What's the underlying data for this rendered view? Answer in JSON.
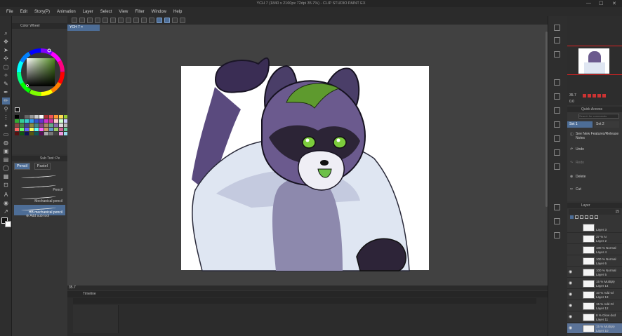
{
  "window": {
    "title": "YCH 7 (1840 x 2160px 72dpi 35.7%)  - CLIP STUDIO PAINT EX",
    "controls": [
      "—",
      "☐",
      "✕"
    ]
  },
  "menu": [
    "File",
    "Edit",
    "Story(P)",
    "Animation",
    "Layer",
    "Select",
    "View",
    "Filter",
    "Window",
    "Help"
  ],
  "color_panel": {
    "title": "Color Wheel",
    "main_color": "#1a1a2e",
    "sub_color": "#ffffff"
  },
  "subtool": {
    "header": "Sub Tool: Pe",
    "tabs": [
      {
        "label": "Pencil",
        "active": true
      },
      {
        "label": "Pastel",
        "active": false
      }
    ],
    "brushes": [
      {
        "label": "",
        "selected": false
      },
      {
        "label": "Pencil",
        "selected": false
      },
      {
        "label": "Mechanical pencil",
        "selected": false
      },
      {
        "label": "HB mechanical pencil",
        "selected": true
      }
    ],
    "add_label": "Add sub tool"
  },
  "document": {
    "tab_label": "YCH 7",
    "zoom": "35.7"
  },
  "timeline": {
    "title": "Timeline"
  },
  "quick_access": {
    "title": "Quick Access",
    "search_placeholder": "Search for commands",
    "sets": [
      {
        "label": "Set 1",
        "active": true
      },
      {
        "label": "Set 2",
        "active": false
      }
    ],
    "items": [
      {
        "label": "See New Features/Release Notes",
        "icon": "info-icon"
      },
      {
        "label": "Undo",
        "icon": "undo-icon"
      },
      {
        "label": "Redo",
        "icon": "redo-icon"
      },
      {
        "label": "Delete",
        "icon": "delete-icon"
      },
      {
        "label": "Cut",
        "icon": "cut-icon"
      }
    ]
  },
  "navigator": {
    "zoom": "35.7",
    "rotation": "0.0"
  },
  "layers": {
    "title": "Layer",
    "opacity": "15",
    "items": [
      {
        "mode": "",
        "name": "Layer 3",
        "visible": false,
        "selected": false
      },
      {
        "mode": "37 % N",
        "name": "Layer 2",
        "visible": false,
        "selected": false
      },
      {
        "mode": "100 % Normal",
        "name": "Layer 4",
        "visible": false,
        "selected": false
      },
      {
        "mode": "100 % Normal",
        "name": "Layer 6",
        "visible": false,
        "selected": false
      },
      {
        "mode": "100 % Normal",
        "name": "Layer 5",
        "visible": true,
        "selected": false
      },
      {
        "mode": "15 % Multiply",
        "name": "Layer 14",
        "visible": true,
        "selected": false
      },
      {
        "mode": "10 % Add Gl",
        "name": "Layer 13",
        "visible": true,
        "selected": false
      },
      {
        "mode": "15 % Add Gl",
        "name": "Layer 12",
        "visible": true,
        "selected": false
      },
      {
        "mode": "8 % Glow dod",
        "name": "Layer 11",
        "visible": true,
        "selected": false
      },
      {
        "mode": "15 % Multiply",
        "name": "Layer 10",
        "visible": true,
        "selected": true
      }
    ]
  },
  "colors": {
    "accent": "#4d6d96",
    "bg": "#333333",
    "canvas": "#ffffff"
  }
}
